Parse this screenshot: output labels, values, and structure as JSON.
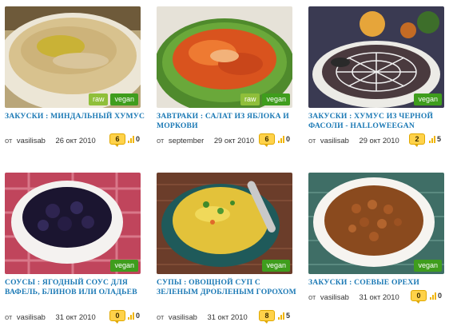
{
  "recipes": [
    {
      "title": "Закуски : Миндальный хумус",
      "tags": [
        "raw",
        "vegan"
      ],
      "by": "от",
      "author": "vasilisab",
      "date": "26 окт 2010",
      "comments": "6",
      "votes": "0"
    },
    {
      "title": "Завтраки : Салат из яблока и моркови",
      "tags": [
        "raw",
        "vegan"
      ],
      "by": "от",
      "author": "september",
      "date": "29 окт 2010",
      "comments": "6",
      "votes": "0"
    },
    {
      "title": "Закуски : Хумус из черной фасоли - Halloweegan",
      "tags": [
        "vegan"
      ],
      "by": "от",
      "author": "vasilisab",
      "date": "29 окт 2010",
      "comments": "2",
      "votes": "5"
    },
    {
      "title": "Соусы : Ягодный соус для вафель, блинов или оладьев",
      "tags": [
        "vegan"
      ],
      "by": "от",
      "author": "vasilisab",
      "date": "31 окт 2010",
      "comments": "0",
      "votes": "0"
    },
    {
      "title": "Супы : Овощной суп с зеленым дробленым горохом",
      "tags": [
        "vegan"
      ],
      "by": "от",
      "author": "vasilisab",
      "date": "31 окт 2010",
      "comments": "8",
      "votes": "5"
    },
    {
      "title": "Закуски : Соевые орехи",
      "tags": [
        "vegan"
      ],
      "by": "от",
      "author": "vasilisab",
      "date": "31 окт 2010",
      "comments": "0",
      "votes": "0"
    }
  ],
  "colors": {
    "link": "#1b79b5",
    "vegan_tag": "#3f9d1d",
    "raw_tag": "#8fbf3a",
    "badge": "#ffd24a"
  }
}
